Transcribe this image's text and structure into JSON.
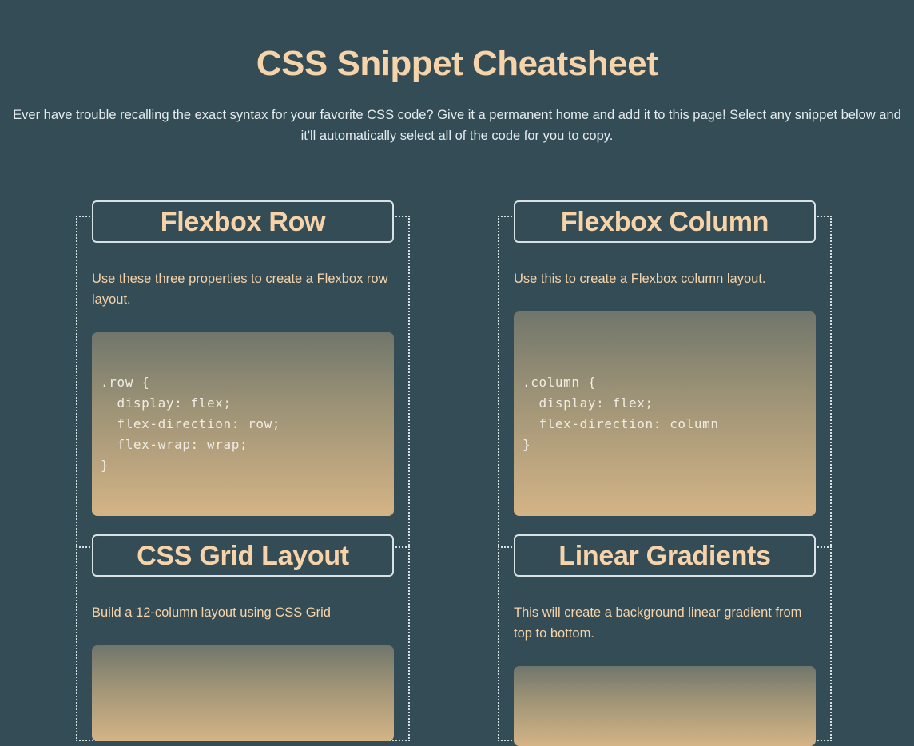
{
  "header": {
    "title": "CSS Snippet Cheatsheet",
    "intro": "Ever have trouble recalling the exact syntax for your favorite CSS code? Give it a permanent home and add it to this page! Select any snippet below and it'll automatically select all of the code for you to copy."
  },
  "snippets": [
    {
      "title": "Flexbox Row",
      "description": "Use these three properties to create a Flexbox row layout.",
      "code": ".row {\n  display: flex;\n  flex-direction: row;\n  flex-wrap: wrap;\n}"
    },
    {
      "title": "Flexbox Column",
      "description": "Use this to create a Flexbox column layout.",
      "code": ".column {\n  display: flex;\n  flex-direction: column\n}"
    },
    {
      "title": "CSS Grid Layout",
      "description": "Build a 12-column layout using CSS Grid",
      "code": ""
    },
    {
      "title": "Linear Gradients",
      "description": "This will create a background linear gradient from top to bottom.",
      "code": ""
    }
  ],
  "colors": {
    "background": "#344c55",
    "accent": "#f6d3a9",
    "text": "#e4ecef",
    "border": "#d7e2e5"
  }
}
